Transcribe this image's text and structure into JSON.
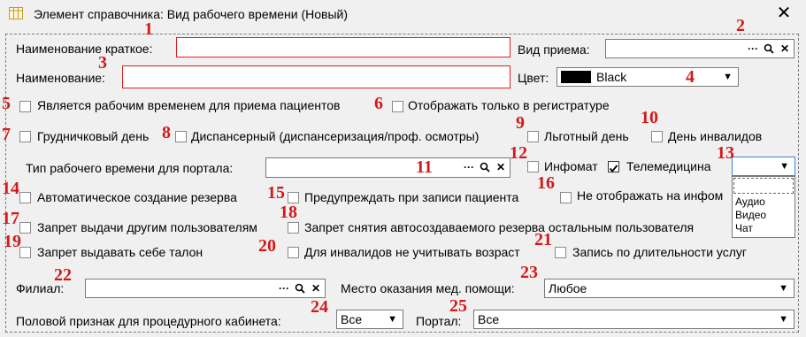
{
  "window": {
    "title": "Элемент справочника: Вид рабочего времени (Новый)",
    "close_glyph": "✕",
    "icon": "table-icon"
  },
  "fields": {
    "short_name_label": "Наименование краткое:",
    "short_name_value": "",
    "name_label": "Наименование:",
    "name_value": "",
    "reception_type_label": "Вид приема:",
    "reception_type_value": "",
    "color_label": "Цвет:",
    "color_value": "Black",
    "color_swatch": "#000000",
    "portal_time_type_label": "Тип рабочего времени для портала:",
    "portal_time_type_value": "",
    "branch_label": "Филиал:",
    "branch_value": "",
    "care_place_label": "Место оказания мед. помощи:",
    "care_place_value": "Любое",
    "gender_label": "Половой признак для процедурного кабинета:",
    "gender_value": "Все",
    "portal_label": "Портал:",
    "portal_value": "Все",
    "telemed_value": ""
  },
  "checkboxes": {
    "is_work_time": {
      "label": "Является рабочим временем для приема пациентов",
      "checked": false
    },
    "registry_only": {
      "label": "Отображать только в регистратуре",
      "checked": false
    },
    "infant_day": {
      "label": "Грудничковый день",
      "checked": false
    },
    "dispensary": {
      "label": "Диспансерный (диспансеризация/проф. осмотры)",
      "checked": false
    },
    "preferential_day": {
      "label": "Льготный день",
      "checked": false
    },
    "disabled_day": {
      "label": "День инвалидов",
      "checked": false
    },
    "infomat": {
      "label": "Инфомат",
      "checked": false
    },
    "telemedicine": {
      "label": "Телемедицина",
      "checked": true
    },
    "auto_reserve": {
      "label": "Автоматическое создание резерва",
      "checked": false
    },
    "warn_on_booking": {
      "label": "Предупреждать при записи пациента",
      "checked": false
    },
    "hide_on_infomat": {
      "label": "Не отображать на инфом",
      "checked": false
    },
    "ban_other_users": {
      "label": "Запрет выдачи другим пользователям",
      "checked": false
    },
    "ban_remove_reserve": {
      "label": "Запрет снятия автосоздаваемого резерва остальным пользователя",
      "checked": false
    },
    "ban_self_ticket": {
      "label": "Запрет выдавать себе талон",
      "checked": false
    },
    "ignore_age_disabled": {
      "label": "Для инвалидов не учитывать возраст",
      "checked": false
    },
    "by_service_duration": {
      "label": "Запись по длительности услуг",
      "checked": false
    }
  },
  "telemed_options": [
    "Аудио",
    "Видео",
    "Чат"
  ],
  "buttons": {
    "dots": "···",
    "search": "🔍",
    "clear": "✕",
    "arrow": "▼"
  },
  "annotations": [
    "1",
    "2",
    "3",
    "4",
    "5",
    "6",
    "7",
    "8",
    "9",
    "10",
    "11",
    "12",
    "13",
    "14",
    "15",
    "16",
    "17",
    "18",
    "19",
    "20",
    "21",
    "22",
    "23",
    "24",
    "25"
  ],
  "colors": {
    "annotation": "#d21919",
    "error_border": "#e02020",
    "background": "#f0f0f0"
  }
}
